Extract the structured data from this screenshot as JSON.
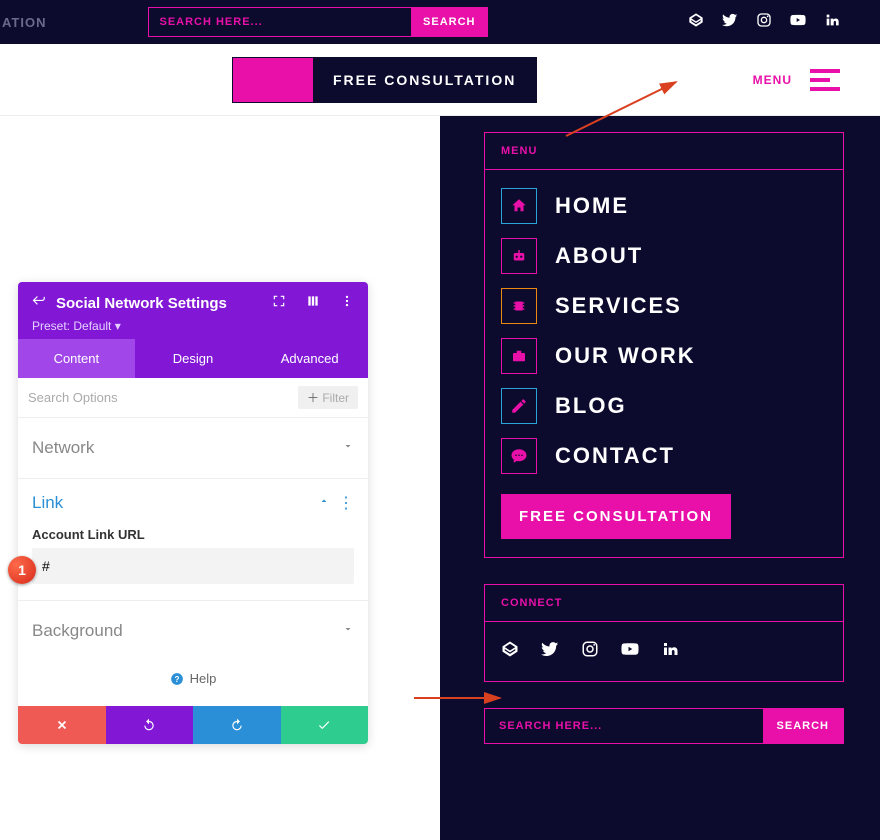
{
  "topbar": {
    "cutoff_text": "ATION",
    "search_placeholder": "SEARCH HERE...",
    "search_btn": "SEARCH"
  },
  "header": {
    "free_consultation": "FREE CONSULTATION",
    "menu_label": "MENU"
  },
  "sidebar": {
    "menu_title": "MENU",
    "items": [
      "HOME",
      "ABOUT",
      "SERVICES",
      "OUR WORK",
      "BLOG",
      "CONTACT"
    ],
    "free_consultation": "FREE CONSULTATION",
    "connect_title": "CONNECT",
    "search_placeholder": "SEARCH HERE...",
    "search_btn": "SEARCH"
  },
  "divi": {
    "title": "Social Network Settings",
    "preset": "Preset: Default",
    "tabs": {
      "content": "Content",
      "design": "Design",
      "advanced": "Advanced"
    },
    "search_opts": "Search Options",
    "filter": "Filter",
    "sections": {
      "network": "Network",
      "link": "Link",
      "background": "Background"
    },
    "link_field_label": "Account Link URL",
    "link_value": "#",
    "help": "Help"
  },
  "badge": "1"
}
